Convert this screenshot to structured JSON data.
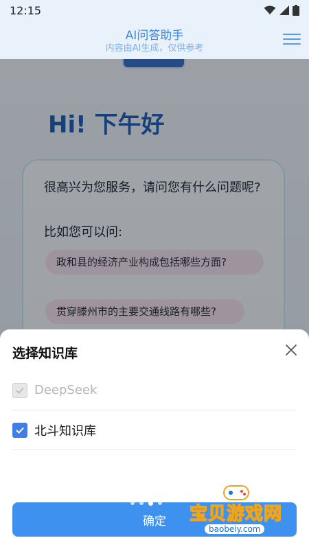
{
  "status_bar": {
    "time": "12:15"
  },
  "header": {
    "title": "AI问答助手",
    "subtitle": "内容由AI生成，仅供参考"
  },
  "main": {
    "greeting": "Hi! 下午好",
    "welcome_text": "很高兴为您服务，请问您有什么问题呢?",
    "example_label": "比如您可以问:",
    "suggestions": [
      "政和县的经济产业构成包括哪些方面?",
      "贯穿滕州市的主要交通线路有哪些?"
    ]
  },
  "sheet": {
    "title": "选择知识库",
    "options": [
      {
        "label": "DeepSeek",
        "checked": true,
        "disabled": true
      },
      {
        "label": "北斗知识库",
        "checked": true,
        "disabled": false
      }
    ],
    "confirm_label": "确定"
  },
  "watermark": {
    "main": "宝贝游戏网",
    "sub": "baobeiy.com"
  },
  "colors": {
    "accent": "#3f91f0",
    "header_bg": "#e9f1fb",
    "greeting": "#1f5fb6"
  }
}
